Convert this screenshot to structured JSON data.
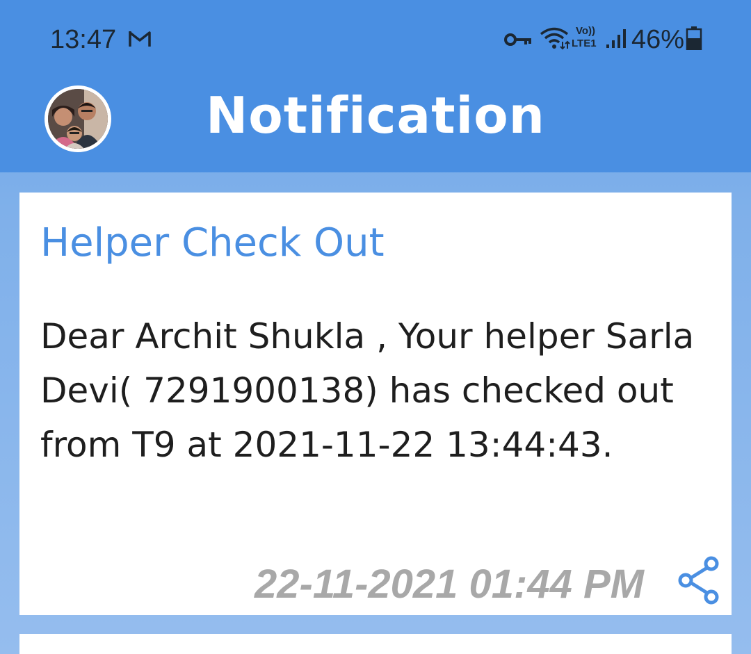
{
  "status_bar": {
    "time": "13:47",
    "notification_icon": "gmail-icon",
    "vpn_icon": "key-icon",
    "wifi_icon": "wifi-icon",
    "volte_line1": "Vo))",
    "volte_line2": "LTE1",
    "signal_icon": "signal-icon",
    "battery_percent": "46%",
    "battery_icon": "battery-icon"
  },
  "header": {
    "title": "Notification",
    "avatar_icon": "profile-photo"
  },
  "notifications": [
    {
      "title": "Helper Check Out",
      "message": "Dear Archit Shukla , Your helper Sarla Devi( 7291900138) has checked out from T9 at 2021-11-22 13:44:43.",
      "date": "22-11-2021 01:44 PM",
      "share_icon": "share-icon"
    }
  ],
  "colors": {
    "appbar": "#4a8fe2",
    "accent": "#4a8fe2",
    "date_text": "#a8a8a8",
    "card_bg": "#ffffff"
  }
}
